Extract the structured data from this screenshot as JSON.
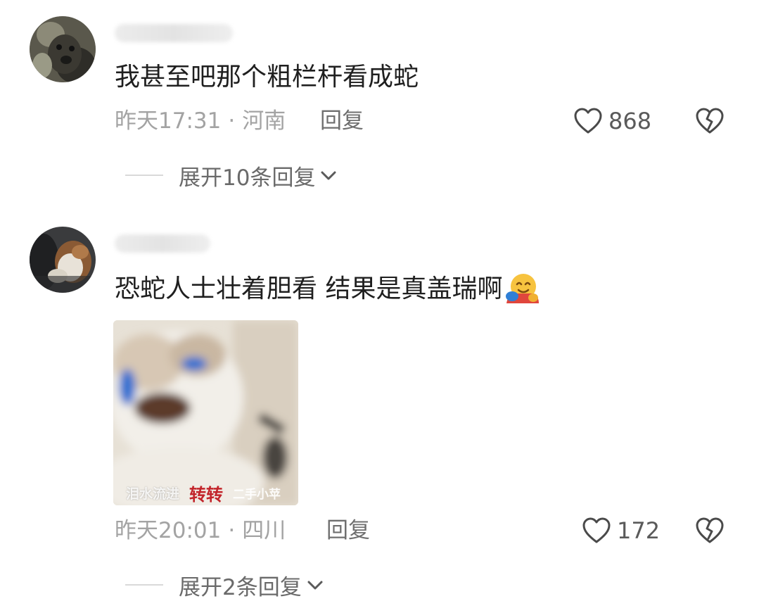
{
  "comments": [
    {
      "text": "我甚至吧那个粗栏杆看成蛇",
      "time": "昨天17:31",
      "location": "河南",
      "separator": "·",
      "reply_label": "回复",
      "likes": "868",
      "expand_label": "展开10条回复",
      "avatar_icon": "dog-avatar",
      "like_icon": "heart-outline-icon",
      "dislike_icon": "broken-heart-icon"
    },
    {
      "text": "恐蛇人士壮着胆看 结果是真盖瑞啊",
      "emoji": "hugging-face-emoji",
      "time": "昨天20:01",
      "location": "四川",
      "separator": "·",
      "reply_label": "回复",
      "likes": "172",
      "expand_label": "展开2条回复",
      "avatar_icon": "cat-avatar",
      "like_icon": "heart-outline-icon",
      "dislike_icon": "broken-heart-icon",
      "sticker": {
        "caption_left": "泪水流进",
        "caption_mid": "转转",
        "caption_right": "二手小苹"
      }
    }
  ],
  "colors": {
    "meta_text": "#a3a3a3",
    "body_text": "#1f1f1f",
    "sticker_red": "#c2242a"
  }
}
